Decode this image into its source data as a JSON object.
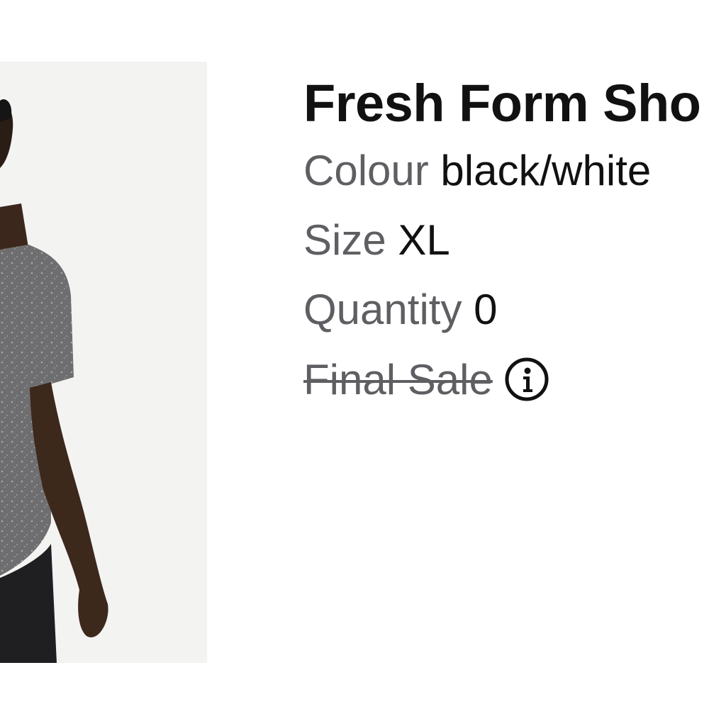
{
  "product": {
    "title": "Fresh Form Sho",
    "colour_label": "Colour",
    "colour_value": "black/white",
    "size_label": "Size",
    "size_value": "XL",
    "quantity_label": "Quantity",
    "quantity_value": "0",
    "final_sale_label": "Final Sale",
    "info_icon": "info-icon",
    "image_alt": "product-photo"
  },
  "colors": {
    "text_primary": "#111111",
    "text_secondary": "#5f5f63",
    "image_background": "#f3f3f2"
  }
}
